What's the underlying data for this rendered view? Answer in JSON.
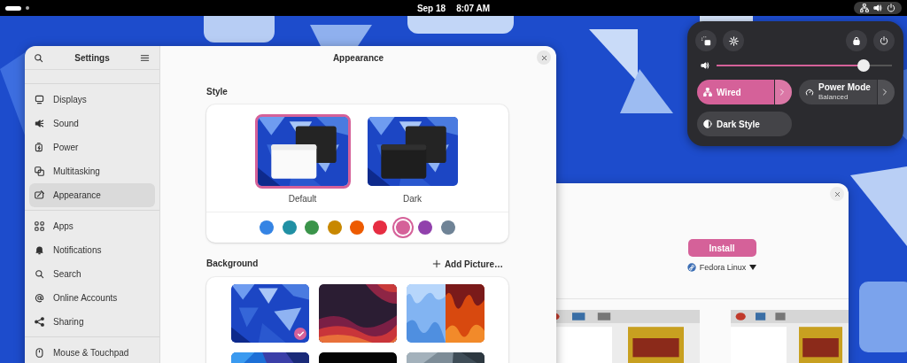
{
  "top_bar": {
    "date": "Sep 18",
    "time": "8:07 AM"
  },
  "settings": {
    "title": "Settings",
    "sidebar": {
      "groups": [
        {
          "items": [
            {
              "label": "Displays",
              "selected": false
            },
            {
              "label": "Sound",
              "selected": false
            },
            {
              "label": "Power",
              "selected": false
            },
            {
              "label": "Multitasking",
              "selected": false
            },
            {
              "label": "Appearance",
              "selected": true
            }
          ]
        },
        {
          "items": [
            {
              "label": "Apps",
              "selected": false
            },
            {
              "label": "Notifications",
              "selected": false
            },
            {
              "label": "Search",
              "selected": false
            },
            {
              "label": "Online Accounts",
              "selected": false
            },
            {
              "label": "Sharing",
              "selected": false
            }
          ]
        },
        {
          "items": [
            {
              "label": "Mouse & Touchpad",
              "selected": false
            }
          ]
        }
      ]
    },
    "page": {
      "title": "Appearance",
      "style": {
        "heading": "Style",
        "options": [
          {
            "label": "Default",
            "selected": true
          },
          {
            "label": "Dark",
            "selected": false
          }
        ],
        "accent_colors": [
          {
            "color": "#3584e4",
            "selected": false
          },
          {
            "color": "#2190a4",
            "selected": false
          },
          {
            "color": "#3a944a",
            "selected": false
          },
          {
            "color": "#c88800",
            "selected": false
          },
          {
            "color": "#ed5b00",
            "selected": false
          },
          {
            "color": "#e62d42",
            "selected": false
          },
          {
            "color": "#d56199",
            "selected": true
          },
          {
            "color": "#9141ac",
            "selected": false
          },
          {
            "color": "#6f8396",
            "selected": false
          }
        ]
      },
      "background": {
        "heading": "Background",
        "add_button": "Add Picture…",
        "wallpapers": [
          {
            "kind": "picture",
            "selected": true
          },
          {
            "kind": "picture",
            "selected": false
          },
          {
            "kind": "picture",
            "selected": false
          },
          {
            "kind": "picture"
          },
          {
            "kind": "picture"
          },
          {
            "kind": "picture"
          }
        ]
      }
    }
  },
  "quick_settings": {
    "volume": {
      "level": 0.84
    },
    "toggles": [
      {
        "label": "Wired",
        "on": true,
        "menu": true
      },
      {
        "label": "Power Mode",
        "subtitle": "Balanced",
        "on": false,
        "menu": true
      },
      {
        "label": "Dark Style",
        "on": false,
        "menu": false
      }
    ]
  },
  "software": {
    "install_button": "Install",
    "source": "Fedora Linux",
    "screenshots": [
      {
        "kind": "picture"
      },
      {
        "kind": "picture"
      }
    ]
  }
}
